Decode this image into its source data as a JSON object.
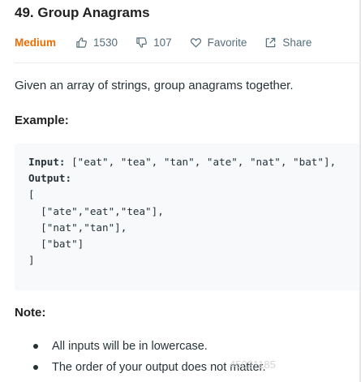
{
  "problem": {
    "title": "49. Group Anagrams",
    "difficulty": "Medium",
    "likes": "1530",
    "dislikes": "107",
    "favorite_label": "Favorite",
    "share_label": "Share",
    "description": "Given an array of strings, group anagrams together."
  },
  "example": {
    "heading": "Example:",
    "input_label": "Input:",
    "input_value": " [\"eat\", \"tea\", \"tan\", \"ate\", \"nat\", \"bat\"],",
    "output_label": "Output:",
    "output_lines": [
      "[",
      "  [\"ate\",\"eat\",\"tea\"],",
      "  [\"nat\",\"tan\"],",
      "  [\"bat\"]",
      "]"
    ]
  },
  "note": {
    "heading": "Note:",
    "items": [
      "All inputs will be in lowercase.",
      "The order of your output does not matter."
    ]
  },
  "watermark": "45021185",
  "colors": {
    "difficulty": "#ef6c00",
    "meta": "#546e7a",
    "code_background": "#f7f9fa"
  },
  "icons": {
    "likes": "thumbs-up-icon",
    "dislikes": "thumbs-down-icon",
    "favorite": "heart-icon",
    "share": "share-icon"
  }
}
